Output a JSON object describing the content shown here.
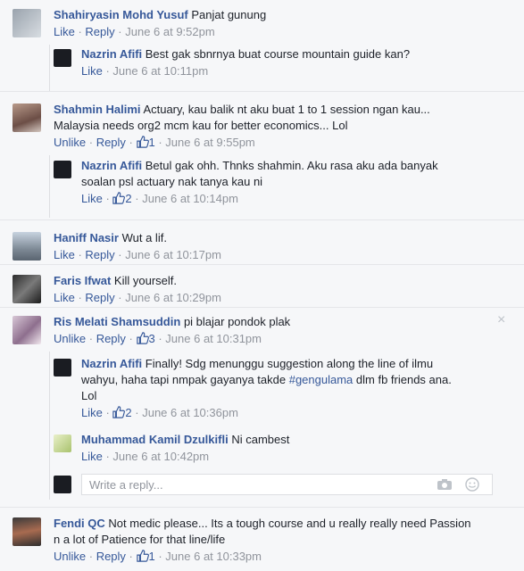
{
  "comments": [
    {
      "author": "Shahiryasin Mohd Yusuf",
      "text": "Panjat gunung",
      "actions": [
        "Like",
        "Reply"
      ],
      "time": "June 6 at 9:52pm"
    },
    {
      "author": "Nazrin Afifi",
      "text": "Best gak sbnrnya buat course mountain guide kan?",
      "actions": [
        "Like"
      ],
      "time": "June 6 at 10:11pm"
    },
    {
      "author": "Shahmin Halimi",
      "text_line1": "Actuary, kau balik nt aku buat 1 to 1 session ngan kau...",
      "text_line2": "Malaysia needs org2 mcm kau for better economics... Lol",
      "actions": [
        "Unlike",
        "Reply"
      ],
      "likes": "1",
      "time": "June 6 at 9:55pm"
    },
    {
      "author": "Nazrin Afifi",
      "text_line1": "Betul gak ohh. Thnks shahmin. Aku rasa aku ada banyak",
      "text_line2": "soalan psl actuary nak tanya kau ni",
      "actions": [
        "Like"
      ],
      "likes": "2",
      "time": "June 6 at 10:14pm"
    },
    {
      "author": "Haniff Nasir",
      "text": "Wut a lif.",
      "actions": [
        "Like",
        "Reply"
      ],
      "time": "June 6 at 10:17pm"
    },
    {
      "author": "Faris Ifwat",
      "text": "Kill yourself.",
      "actions": [
        "Like",
        "Reply"
      ],
      "time": "June 6 at 10:29pm"
    },
    {
      "author": "Ris Melati Shamsuddin",
      "text": "pi blajar pondok plak",
      "actions": [
        "Unlike",
        "Reply"
      ],
      "likes": "3",
      "time": "June 6 at 10:31pm"
    },
    {
      "author": "Nazrin Afifi",
      "text_line1": "Finally! Sdg menunggu suggestion along the line of ilmu",
      "text_line2a": "wahyu, haha tapi nmpak gayanya takde ",
      "hashtag": "#gengulama",
      "text_line2b": " dlm fb friends ana.",
      "text_line3": "Lol",
      "actions": [
        "Like"
      ],
      "likes": "2",
      "time": "June 6 at 10:36pm"
    },
    {
      "author": "Muhammad Kamil Dzulkifli",
      "text": "Ni cambest",
      "actions": [
        "Like"
      ],
      "time": "June 6 at 10:42pm"
    },
    {
      "author": "Fendi QC",
      "text_line1": "Not medic please... Its a tough course and u really really need Passion",
      "text_line2": "n a lot of Patience for that line/life",
      "actions": [
        "Unlike",
        "Reply"
      ],
      "likes": "1",
      "time": "June 6 at 10:33pm"
    }
  ],
  "reply_box": {
    "placeholder": "Write a reply..."
  },
  "separator": " · ",
  "close_glyph": "×",
  "colors": {
    "link": "#365899",
    "meta": "#90949c",
    "text": "#1d2129",
    "bg": "#f6f7f9"
  }
}
